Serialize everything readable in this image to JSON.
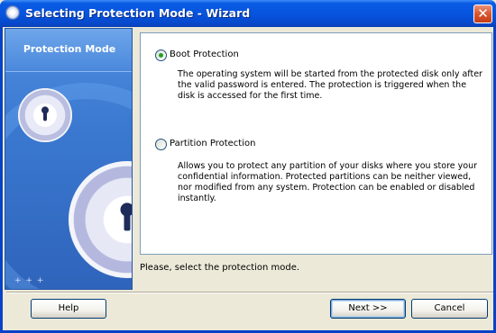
{
  "window": {
    "title": "Selecting Protection Mode - Wizard"
  },
  "sidebar": {
    "title": "Protection Mode",
    "dots": "+ + +"
  },
  "options": [
    {
      "label": "Boot Protection",
      "selected": true,
      "description": "The operating system will be started from the protected disk only after the valid password is entered. The protection is triggered when the disk is accessed for the first time."
    },
    {
      "label": "Partition Protection",
      "selected": false,
      "description": "Allows you to protect any partition of your disks where you store your confidential information. Protected partitions can be neither viewed, nor modified from any system. Protection can be enabled or disabled instantly."
    }
  ],
  "status": "Please, select the protection mode.",
  "buttons": {
    "help": "Help",
    "next": "Next >>",
    "cancel": "Cancel"
  },
  "icons": {
    "close": "close-icon",
    "app": "shield-gear-icon"
  },
  "colors": {
    "titlebar": "#0653de",
    "sidebar": "#3a78d0",
    "selected_radio": "#21a121"
  }
}
